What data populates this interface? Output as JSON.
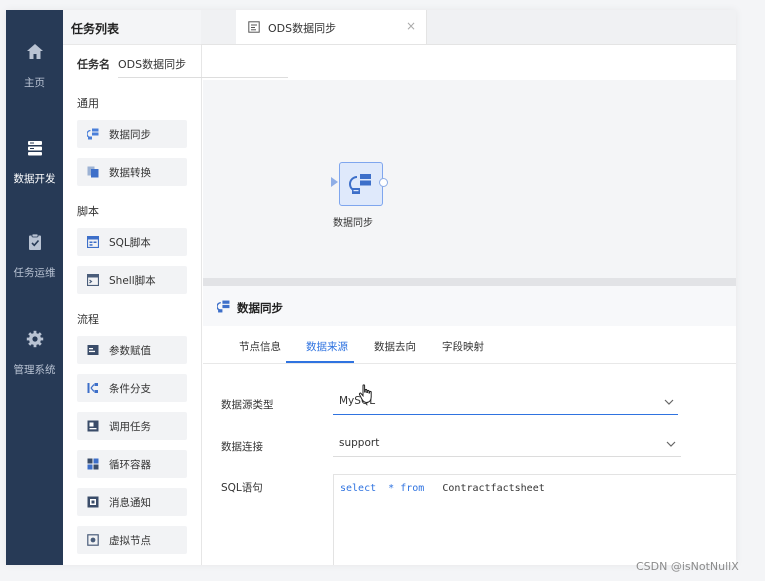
{
  "nav": {
    "items": [
      {
        "label": "主页",
        "icon": "home-icon",
        "active": false
      },
      {
        "label": "数据开发",
        "icon": "server-icon",
        "active": true
      },
      {
        "label": "任务运维",
        "icon": "clipboard-check-icon",
        "active": false
      },
      {
        "label": "管理系统",
        "icon": "gear-icon",
        "active": false
      }
    ]
  },
  "task_panel": {
    "title": "任务列表",
    "task_name_label": "任务名",
    "task_name_value": "ODS数据同步",
    "groups": [
      {
        "label": "通用",
        "items": [
          {
            "label": "数据同步",
            "icon": "data-sync-icon"
          },
          {
            "label": "数据转换",
            "icon": "data-transform-icon"
          }
        ]
      },
      {
        "label": "脚本",
        "items": [
          {
            "label": "SQL脚本",
            "icon": "sql-script-icon"
          },
          {
            "label": "Shell脚本",
            "icon": "shell-script-icon"
          }
        ]
      },
      {
        "label": "流程",
        "items": [
          {
            "label": "参数赋值",
            "icon": "param-assign-icon"
          },
          {
            "label": "条件分支",
            "icon": "condition-branch-icon"
          },
          {
            "label": "调用任务",
            "icon": "call-task-icon"
          },
          {
            "label": "循环容器",
            "icon": "loop-container-icon"
          },
          {
            "label": "消息通知",
            "icon": "message-notify-icon"
          },
          {
            "label": "虚拟节点",
            "icon": "virtual-node-icon"
          }
        ]
      }
    ]
  },
  "tab": {
    "label": "ODS数据同步",
    "close": "×"
  },
  "canvas": {
    "node_label": "数据同步"
  },
  "props": {
    "title": "数据同步",
    "tabs": [
      "节点信息",
      "数据来源",
      "数据去向",
      "字段映射"
    ],
    "active_tab": "数据来源",
    "fields": {
      "source_type_label": "数据源类型",
      "source_type_value": "MySQL",
      "connection_label": "数据连接",
      "connection_value": "support",
      "sql_label": "SQL语句",
      "sql_kw1": "select",
      "sql_star": "*",
      "sql_kw2": "from",
      "sql_table": "Contractfactsheet"
    }
  },
  "watermark": "CSDN @isNotNullX",
  "colors": {
    "nav_bg": "#273a56",
    "accent": "#2f73e0",
    "canvas_bg": "#f4f5f7"
  }
}
